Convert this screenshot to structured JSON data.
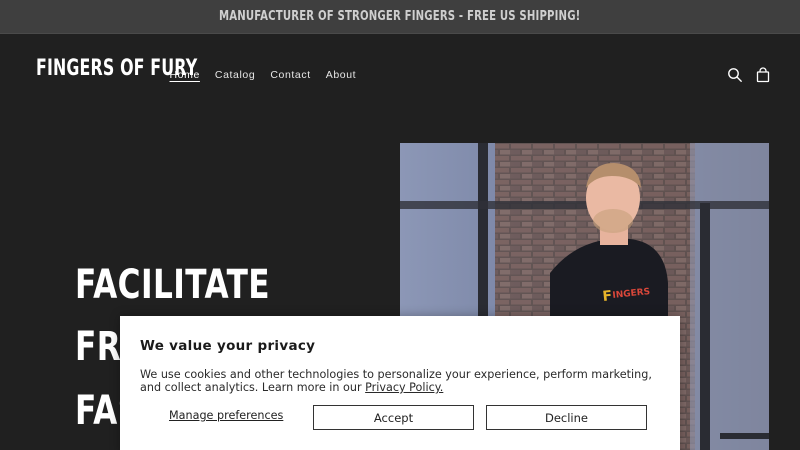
{
  "announcement": {
    "text": "MANUFACTURER OF STRONGER FINGERS - FREE US SHIPPING!"
  },
  "header": {
    "logo_text": "FINGERS OF FURY",
    "nav": [
      {
        "label": "Home",
        "active": true
      },
      {
        "label": "Catalog",
        "active": false
      },
      {
        "label": "Contact",
        "active": false
      },
      {
        "label": "About",
        "active": false
      }
    ],
    "icons": [
      "search-icon",
      "cart-icon"
    ]
  },
  "hero": {
    "title_lines": [
      "FACILITATE",
      "FRE",
      "FAS"
    ],
    "image": "man-in-gym-photo",
    "shirt_text": "FINGERS OF FURY"
  },
  "cookie_banner": {
    "title": "We value your privacy",
    "body": "We use cookies and other technologies to personalize your experience, perform marketing, and collect analytics. Learn more in our ",
    "privacy_link": "Privacy Policy.",
    "manage_label": "Manage preferences",
    "accept_label": "Accept",
    "decline_label": "Decline"
  },
  "colors": {
    "page_bg": "#202020",
    "announce_bg": "#3f3f3f",
    "banner_bg": "#ffffff"
  }
}
